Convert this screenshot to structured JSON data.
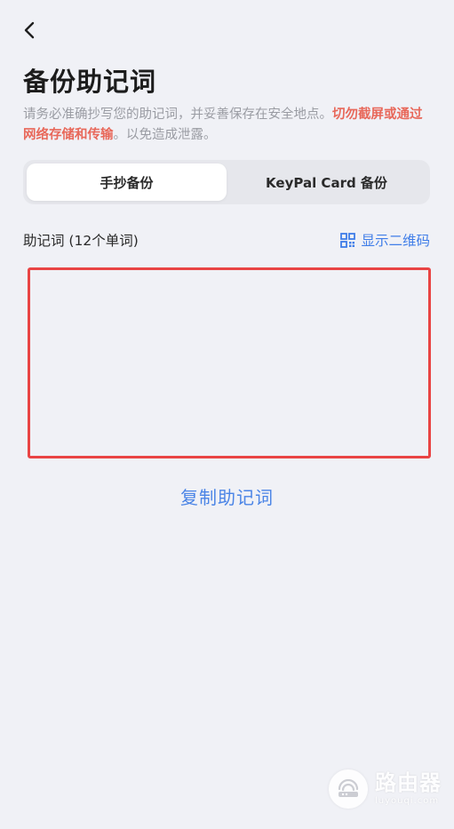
{
  "header": {
    "back_icon": "chevron-left-icon",
    "title": "备份助记词"
  },
  "description": {
    "normal_part": "请务必准确抄写您的助记词，并妥善保存在安全地点。",
    "warning_part": "切勿截屏或通过网络存储和传输",
    "tail_part": "。以免造成泄露。",
    "warning_color": "#e8685a"
  },
  "tabs": [
    {
      "label": "手抄备份",
      "active": true
    },
    {
      "label": "KeyPal Card 备份",
      "active": false
    }
  ],
  "mnemonic": {
    "label": "助记词 (12个单词)",
    "qr_label": "显示二维码",
    "qr_icon": "qr-code-icon",
    "box_border_color": "#e94444"
  },
  "actions": {
    "copy_label": "复制助记词",
    "accent_color": "#4a84e6"
  },
  "watermark": {
    "title": "路由器",
    "subtitle": "luyouqi.com"
  }
}
